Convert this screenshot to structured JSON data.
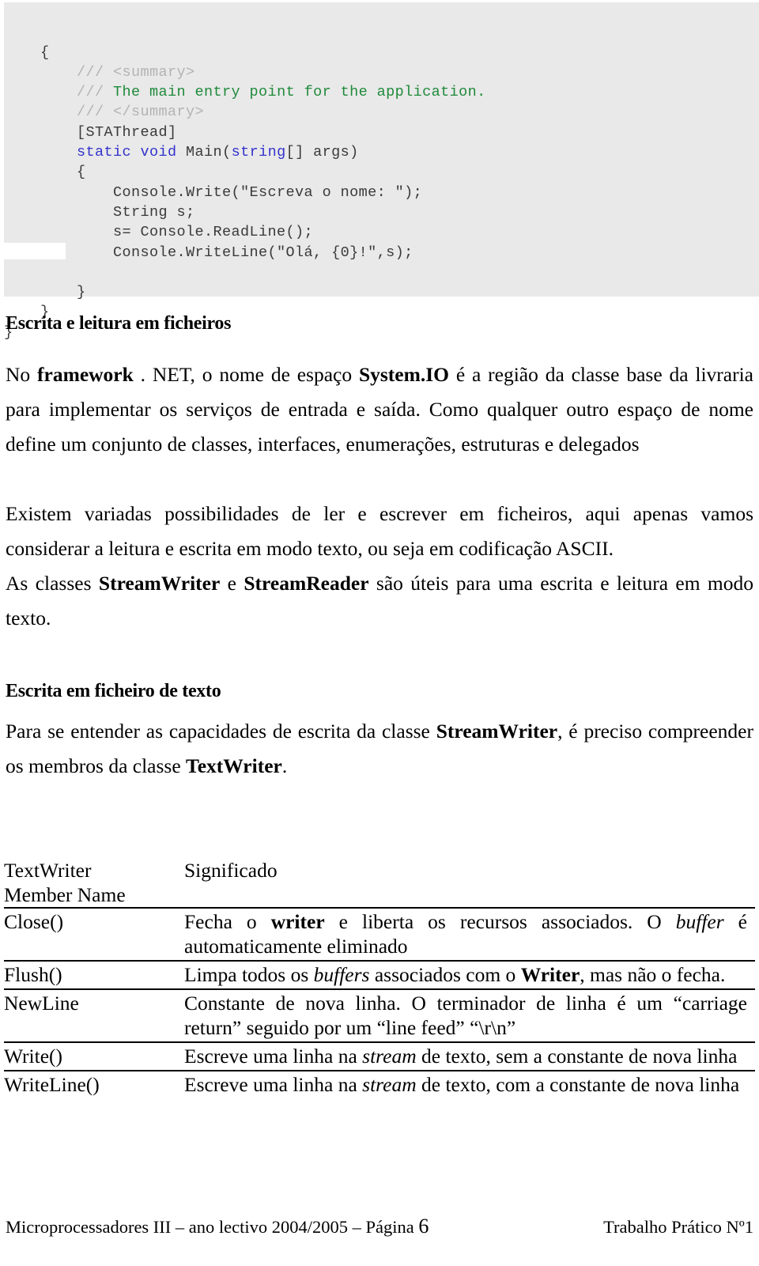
{
  "code_block": {
    "lines": [
      [
        {
          "t": "    {",
          "c": "plain"
        }
      ],
      [
        {
          "t": "        ",
          "c": "plain"
        },
        {
          "t": "/// ",
          "c": "dim"
        },
        {
          "t": "<summary>",
          "c": "dim"
        }
      ],
      [
        {
          "t": "        ",
          "c": "plain"
        },
        {
          "t": "/// ",
          "c": "dim"
        },
        {
          "t": "The main entry point for the application.",
          "c": "green"
        }
      ],
      [
        {
          "t": "        ",
          "c": "plain"
        },
        {
          "t": "/// ",
          "c": "dim"
        },
        {
          "t": "</summary>",
          "c": "dim"
        }
      ],
      [
        {
          "t": "        [STAThread]",
          "c": "plain"
        }
      ],
      [
        {
          "t": "        ",
          "c": "plain"
        },
        {
          "t": "static void ",
          "c": "blue"
        },
        {
          "t": "Main(",
          "c": "plain"
        },
        {
          "t": "string",
          "c": "blue"
        },
        {
          "t": "[] args)",
          "c": "plain"
        }
      ],
      [
        {
          "t": "        {",
          "c": "plain"
        }
      ],
      [
        {
          "t": "            Console.Write(\"Escreva o nome: \");",
          "c": "plain"
        }
      ],
      [
        {
          "t": "            String s;",
          "c": "plain"
        }
      ],
      [
        {
          "t": "            s= Console.ReadLine();",
          "c": "plain"
        }
      ],
      [
        {
          "t": "            Console.WriteLine(\"Olá, {0}!\",s);",
          "c": "plain"
        }
      ],
      [
        {
          "t": " ",
          "c": "plain"
        }
      ],
      [
        {
          "t": "        }",
          "c": "plain"
        }
      ],
      [
        {
          "t": "    }",
          "c": "plain"
        }
      ],
      [
        {
          "t": "}",
          "c": "plain"
        }
      ]
    ]
  },
  "sections": {
    "heading_ficheiros": "Escrita e leitura em ficheiros",
    "para_io_1": "No ",
    "para_io_framework": "framework",
    "para_io_2": " . NET, o nome de espaço ",
    "para_io_systemio": "System.IO",
    "para_io_3": " é a região da classe base da livraria para implementar os serviços de entrada e saída. Como qualquer outro espaço de nome define um conjunto de classes, interfaces, enumerações, estruturas e delegados",
    "para_possibilidades": "Existem variadas possibilidades de ler e escrever em ficheiros, aqui apenas vamos considerar a leitura e escrita em modo texto, ou seja em codificação ASCII.",
    "para_classes_1": "As classes ",
    "para_classes_sw": "StreamWriter",
    "para_classes_2": " e ",
    "para_classes_sr": "StreamReader",
    "para_classes_3": " são úteis para uma escrita e leitura em modo texto.",
    "heading_escrita_texto": "Escrita em ficheiro de texto",
    "para_entender_1": "Para se entender as capacidades de escrita da classe ",
    "para_entender_sw": "StreamWriter",
    "para_entender_2": ", é preciso compreender os membros da classe ",
    "para_entender_tw": "TextWriter",
    "para_entender_3": "."
  },
  "table": {
    "header": {
      "member_line1": "TextWriter",
      "member_line2": "Member Name",
      "meaning": "Significado"
    },
    "rows": [
      {
        "member": "Close()",
        "parts": [
          {
            "t": "Fecha o ",
            "s": "normal"
          },
          {
            "t": "writer",
            "s": "bold"
          },
          {
            "t": " e liberta os recursos associados. O ",
            "s": "normal"
          },
          {
            "t": "buffer",
            "s": "italic"
          },
          {
            "t": " é automaticamente eliminado",
            "s": "normal"
          }
        ]
      },
      {
        "member": "Flush()",
        "parts": [
          {
            "t": "Limpa todos os ",
            "s": "normal"
          },
          {
            "t": "buffers",
            "s": "italic"
          },
          {
            "t": " associados com o ",
            "s": "normal"
          },
          {
            "t": "Writer",
            "s": "bold"
          },
          {
            "t": ", mas não o fecha.",
            "s": "normal"
          }
        ]
      },
      {
        "member": "NewLine",
        "parts": [
          {
            "t": "Constante de nova linha. O terminador de linha é um “carriage return” seguido por um “line feed” “\\r\\n”",
            "s": "normal"
          }
        ]
      },
      {
        "member": "Write()",
        "parts": [
          {
            "t": "Escreve uma linha na ",
            "s": "normal"
          },
          {
            "t": "stream",
            "s": "italic"
          },
          {
            "t": " de texto, sem a constante de nova linha",
            "s": "normal"
          }
        ]
      },
      {
        "member": "WriteLine()",
        "parts": [
          {
            "t": "Escreve uma linha na ",
            "s": "normal"
          },
          {
            "t": "stream",
            "s": "italic"
          },
          {
            "t": " de texto, com a constante de nova linha",
            "s": "normal"
          }
        ]
      }
    ]
  },
  "footer": {
    "left_before": "Microprocessadores III – ano lectivo 2004/2005 – Página ",
    "page_number": "6",
    "right": "Trabalho Prático Nº1"
  }
}
